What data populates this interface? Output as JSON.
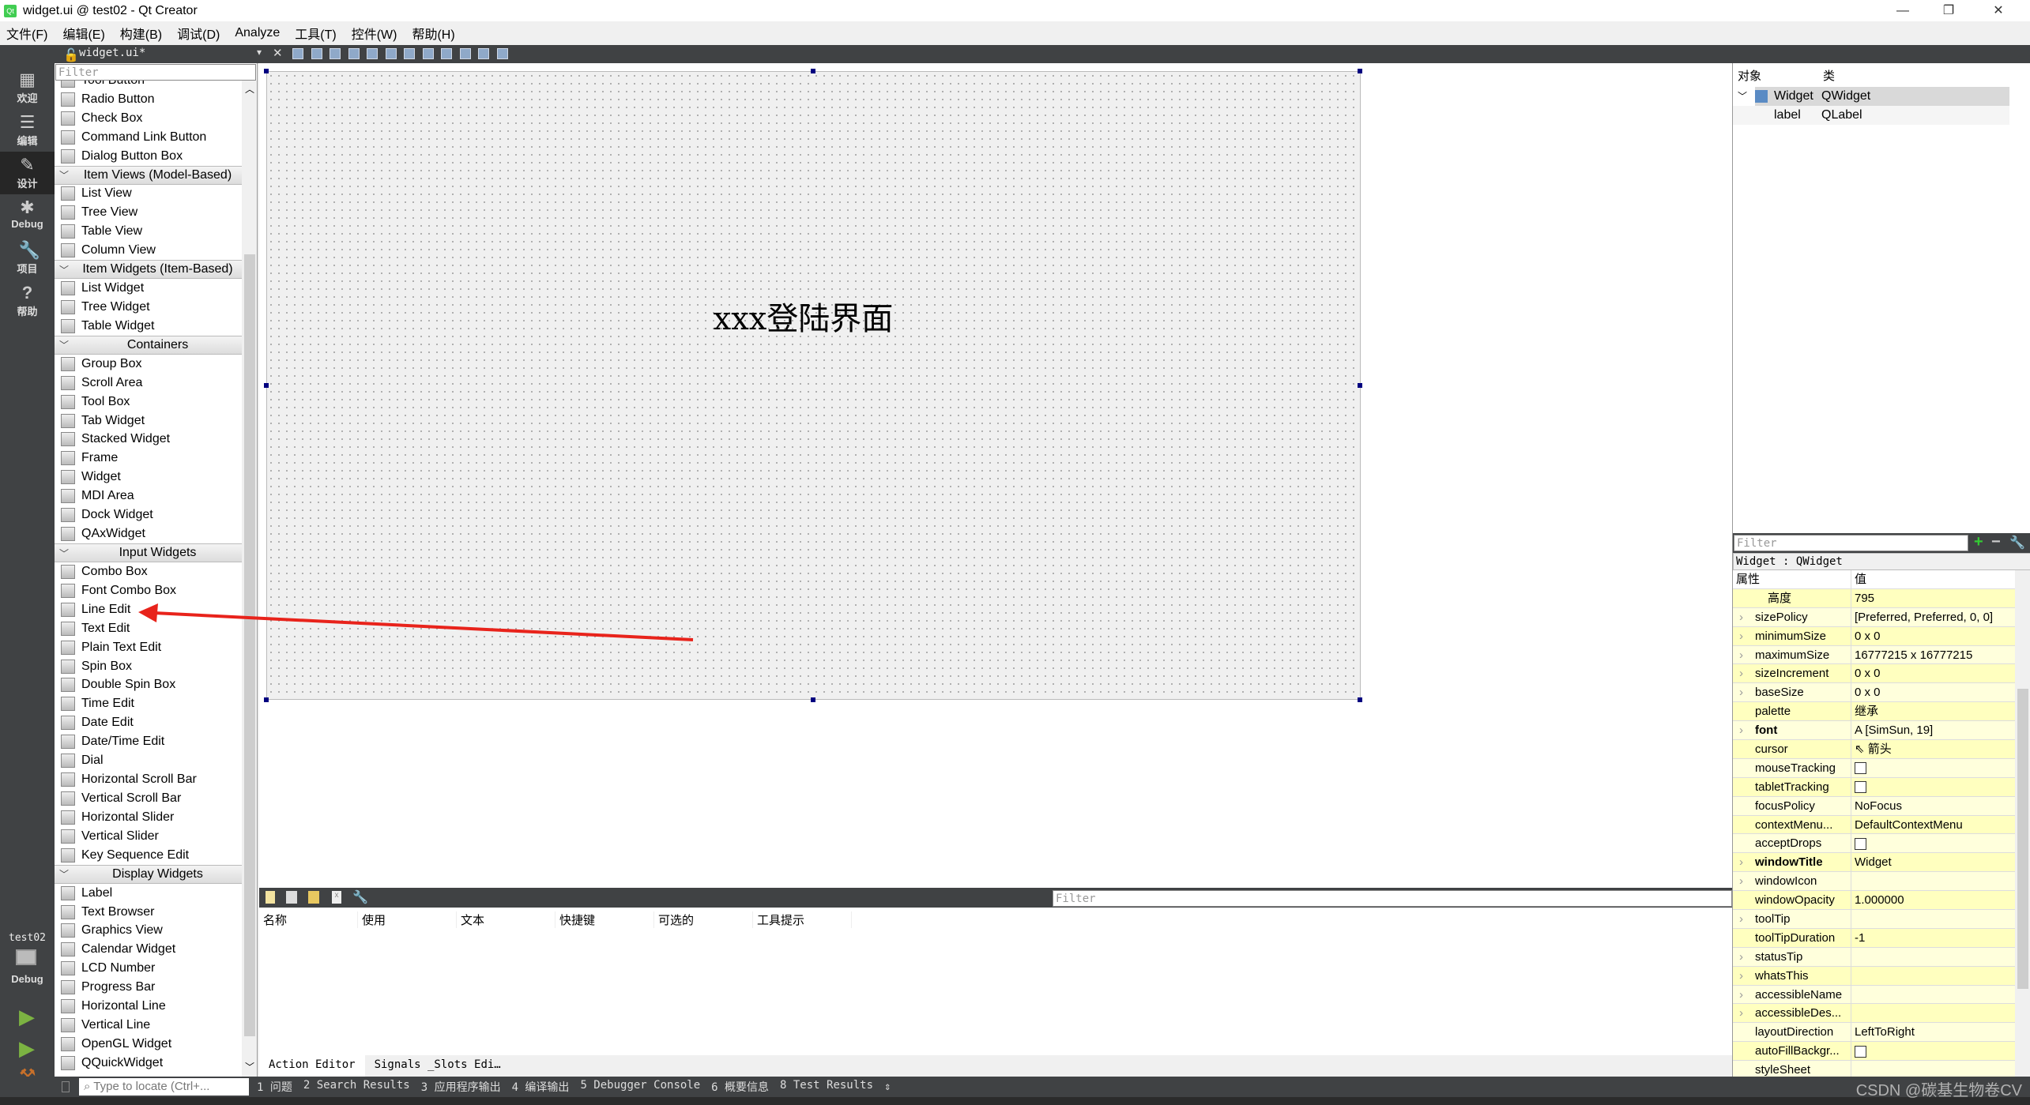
{
  "window": {
    "title": "widget.ui @ test02 - Qt Creator",
    "controls": [
      "—",
      "❐",
      "✕"
    ]
  },
  "menu": [
    "文件(F)",
    "编辑(E)",
    "构建(B)",
    "调试(D)",
    "Analyze",
    "工具(T)",
    "控件(W)",
    "帮助(H)"
  ],
  "toolbar": {
    "file_name": "widget.ui*",
    "close": "✕"
  },
  "modes": [
    {
      "label": "欢迎",
      "icon": "▦"
    },
    {
      "label": "编辑",
      "icon": "☰"
    },
    {
      "label": "设计",
      "icon": "✎",
      "active": true
    },
    {
      "label": "Debug",
      "icon": "✱"
    },
    {
      "label": "项目",
      "icon": "🔧"
    },
    {
      "label": "帮助",
      "icon": "?"
    }
  ],
  "target": {
    "project": "test02",
    "config": "Debug"
  },
  "widget_box": {
    "filter_placeholder": "Filter",
    "items": [
      {
        "t": "i",
        "l": "Tool Button"
      },
      {
        "t": "i",
        "l": "Radio Button"
      },
      {
        "t": "i",
        "l": "Check Box"
      },
      {
        "t": "i",
        "l": "Command Link Button"
      },
      {
        "t": "i",
        "l": "Dialog Button Box"
      },
      {
        "t": "h",
        "l": "Item Views (Model-Based)"
      },
      {
        "t": "i",
        "l": "List View"
      },
      {
        "t": "i",
        "l": "Tree View"
      },
      {
        "t": "i",
        "l": "Table View"
      },
      {
        "t": "i",
        "l": "Column View"
      },
      {
        "t": "h",
        "l": "Item Widgets (Item-Based)"
      },
      {
        "t": "i",
        "l": "List Widget"
      },
      {
        "t": "i",
        "l": "Tree Widget"
      },
      {
        "t": "i",
        "l": "Table Widget"
      },
      {
        "t": "h",
        "l": "Containers"
      },
      {
        "t": "i",
        "l": "Group Box"
      },
      {
        "t": "i",
        "l": "Scroll Area"
      },
      {
        "t": "i",
        "l": "Tool Box"
      },
      {
        "t": "i",
        "l": "Tab Widget"
      },
      {
        "t": "i",
        "l": "Stacked Widget"
      },
      {
        "t": "i",
        "l": "Frame"
      },
      {
        "t": "i",
        "l": "Widget"
      },
      {
        "t": "i",
        "l": "MDI Area"
      },
      {
        "t": "i",
        "l": "Dock Widget"
      },
      {
        "t": "i",
        "l": "QAxWidget"
      },
      {
        "t": "h",
        "l": "Input Widgets"
      },
      {
        "t": "i",
        "l": "Combo Box"
      },
      {
        "t": "i",
        "l": "Font Combo Box"
      },
      {
        "t": "i",
        "l": "Line Edit"
      },
      {
        "t": "i",
        "l": "Text Edit"
      },
      {
        "t": "i",
        "l": "Plain Text Edit"
      },
      {
        "t": "i",
        "l": "Spin Box"
      },
      {
        "t": "i",
        "l": "Double Spin Box"
      },
      {
        "t": "i",
        "l": "Time Edit"
      },
      {
        "t": "i",
        "l": "Date Edit"
      },
      {
        "t": "i",
        "l": "Date/Time Edit"
      },
      {
        "t": "i",
        "l": "Dial"
      },
      {
        "t": "i",
        "l": "Horizontal Scroll Bar"
      },
      {
        "t": "i",
        "l": "Vertical Scroll Bar"
      },
      {
        "t": "i",
        "l": "Horizontal Slider"
      },
      {
        "t": "i",
        "l": "Vertical Slider"
      },
      {
        "t": "i",
        "l": "Key Sequence Edit"
      },
      {
        "t": "h",
        "l": "Display Widgets"
      },
      {
        "t": "i",
        "l": "Label"
      },
      {
        "t": "i",
        "l": "Text Browser"
      },
      {
        "t": "i",
        "l": "Graphics View"
      },
      {
        "t": "i",
        "l": "Calendar Widget"
      },
      {
        "t": "i",
        "l": "LCD Number"
      },
      {
        "t": "i",
        "l": "Progress Bar"
      },
      {
        "t": "i",
        "l": "Horizontal Line"
      },
      {
        "t": "i",
        "l": "Vertical Line"
      },
      {
        "t": "i",
        "l": "OpenGL Widget"
      },
      {
        "t": "i",
        "l": "QQuickWidget"
      }
    ]
  },
  "form": {
    "label_text": "xxx登陆界面",
    "annotation_color": "#e8231b"
  },
  "action_editor": {
    "filter_placeholder": "Filter",
    "columns": [
      "名称",
      "使用",
      "文本",
      "快捷键",
      "可选的",
      "工具提示"
    ],
    "tabs": [
      "Action Editor",
      "Signals _Slots Edi…"
    ]
  },
  "object_inspector": {
    "columns": [
      "对象",
      "类"
    ],
    "rows": [
      {
        "object": "Widget",
        "class": "QWidget"
      },
      {
        "object": "label",
        "class": "QLabel"
      }
    ]
  },
  "property_editor": {
    "filter_placeholder": "Filter",
    "context": "Widget : QWidget",
    "columns": [
      "属性",
      "值"
    ],
    "rows": [
      {
        "n": "高度",
        "v": "795",
        "sub": true
      },
      {
        "n": "sizePolicy",
        "v": "[Preferred, Preferred, 0, 0]",
        "e": true
      },
      {
        "n": "minimumSize",
        "v": "0 x 0",
        "e": true
      },
      {
        "n": "maximumSize",
        "v": "16777215 x 16777215",
        "e": true
      },
      {
        "n": "sizeIncrement",
        "v": "0 x 0",
        "e": true
      },
      {
        "n": "baseSize",
        "v": "0 x 0",
        "e": true
      },
      {
        "n": "palette",
        "v": "继承"
      },
      {
        "n": "font",
        "v": "A  [SimSun, 19]",
        "e": true,
        "b": true
      },
      {
        "n": "cursor",
        "v": "⇖ 箭头"
      },
      {
        "n": "mouseTracking",
        "cb": true
      },
      {
        "n": "tabletTracking",
        "cb": true
      },
      {
        "n": "focusPolicy",
        "v": "NoFocus"
      },
      {
        "n": "contextMenu...",
        "v": "DefaultContextMenu"
      },
      {
        "n": "acceptDrops",
        "cb": true
      },
      {
        "n": "windowTitle",
        "v": "Widget",
        "e": true,
        "b": true
      },
      {
        "n": "windowIcon",
        "v": "",
        "e": true
      },
      {
        "n": "windowOpacity",
        "v": "1.000000"
      },
      {
        "n": "toolTip",
        "v": "",
        "e": true
      },
      {
        "n": "toolTipDuration",
        "v": "-1"
      },
      {
        "n": "statusTip",
        "v": "",
        "e": true
      },
      {
        "n": "whatsThis",
        "v": "",
        "e": true
      },
      {
        "n": "accessibleName",
        "v": "",
        "e": true
      },
      {
        "n": "accessibleDes...",
        "v": "",
        "e": true
      },
      {
        "n": "layoutDirection",
        "v": "LeftToRight"
      },
      {
        "n": "autoFillBackgr...",
        "cb": true
      },
      {
        "n": "styleSheet",
        "v": ""
      }
    ]
  },
  "statusbar": {
    "locator_placeholder": "Type to locate (Ctrl+...",
    "panes": [
      "1 问题",
      "2 Search Results",
      "3 应用程序输出",
      "4 编译输出",
      "5 Debugger Console",
      "6 概要信息",
      "8 Test Results"
    ],
    "more": "⇕"
  },
  "watermark": "CSDN @碳基生物卷CV"
}
